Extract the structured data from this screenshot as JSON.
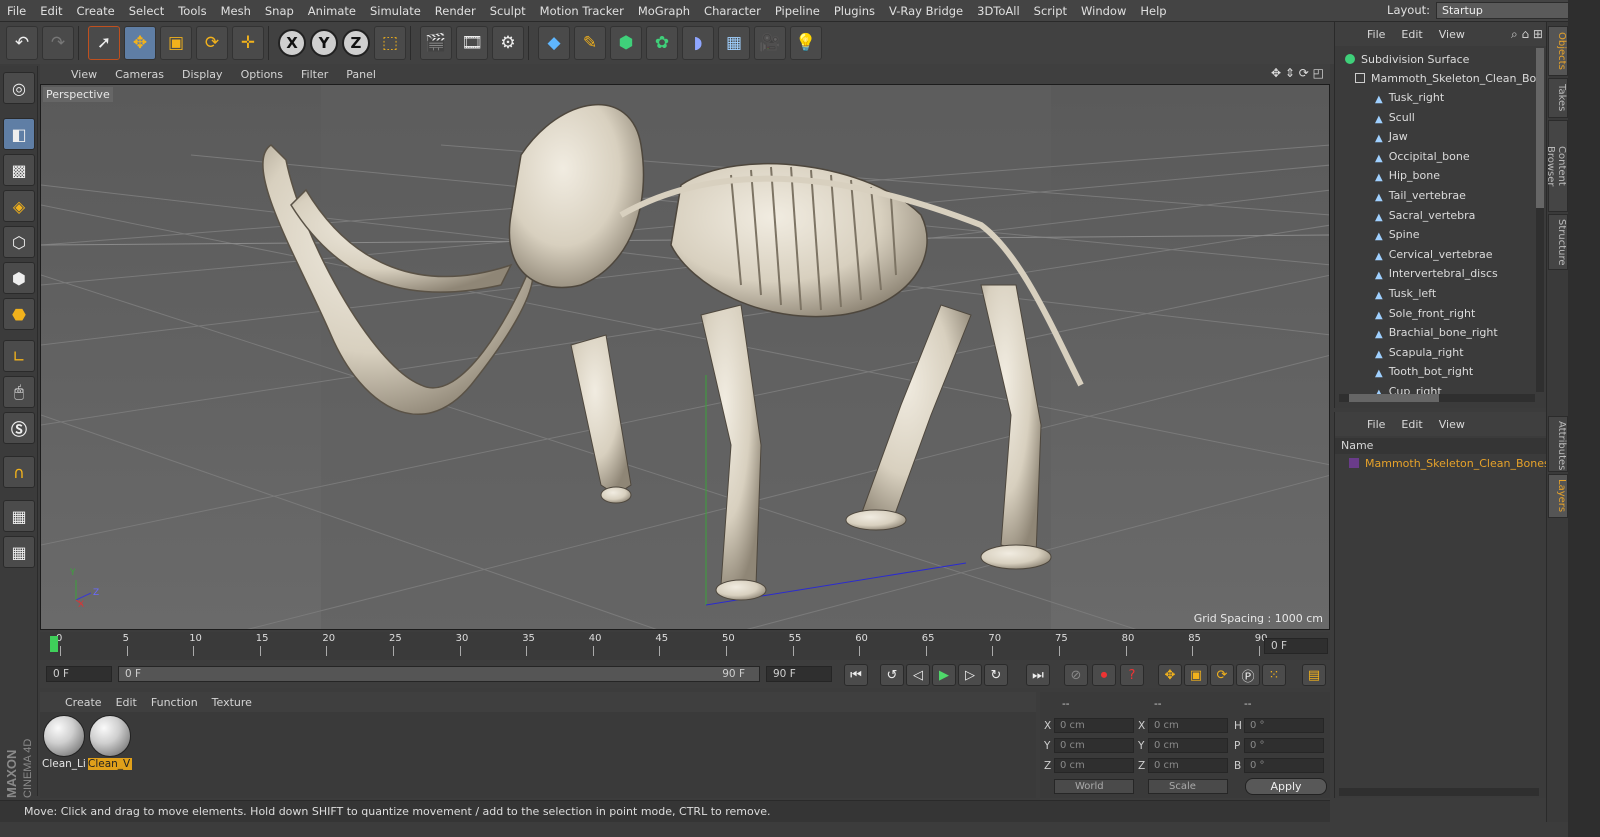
{
  "menubar": {
    "items": [
      "File",
      "Edit",
      "Create",
      "Select",
      "Tools",
      "Mesh",
      "Snap",
      "Animate",
      "Simulate",
      "Render",
      "Sculpt",
      "Motion Tracker",
      "MoGraph",
      "Character",
      "Pipeline",
      "Plugins",
      "V-Ray Bridge",
      "3DToAll",
      "Script",
      "Window",
      "Help"
    ],
    "layout_label": "Layout:",
    "layout_value": "Startup"
  },
  "toolbar": {
    "axis_x": "X",
    "axis_y": "Y",
    "axis_z": "Z"
  },
  "viewport": {
    "menu": [
      "View",
      "Cameras",
      "Display",
      "Options",
      "Filter",
      "Panel"
    ],
    "camera_label": "Perspective",
    "grid_spacing": "Grid Spacing : 1000 cm",
    "axis_labels": {
      "x": "X",
      "y": "Y",
      "z": "Z"
    }
  },
  "timeline": {
    "ticks": [
      "0",
      "5",
      "10",
      "15",
      "20",
      "25",
      "30",
      "35",
      "40",
      "45",
      "50",
      "55",
      "60",
      "65",
      "70",
      "75",
      "80",
      "85",
      "90"
    ],
    "current_frame": "0 F"
  },
  "transport": {
    "start_field": "0 F",
    "range_start": "0 F",
    "range_end": "90 F",
    "end_field": "90 F"
  },
  "material_manager": {
    "menu": [
      "Create",
      "Edit",
      "Function",
      "Texture"
    ],
    "materials": [
      {
        "name": "Clean_Li",
        "selected": false
      },
      {
        "name": "Clean_V",
        "selected": true
      }
    ]
  },
  "coordinates": {
    "header_a": "--",
    "header_b": "--",
    "header_c": "--",
    "rows": [
      {
        "l1": "X",
        "v1": "0 cm",
        "l2": "X",
        "v2": "0 cm",
        "l3": "H",
        "v3": "0 °"
      },
      {
        "l1": "Y",
        "v1": "0 cm",
        "l2": "Y",
        "v2": "0 cm",
        "l3": "P",
        "v3": "0 °"
      },
      {
        "l1": "Z",
        "v1": "0 cm",
        "l2": "Z",
        "v2": "0 cm",
        "l3": "B",
        "v3": "0 °"
      }
    ],
    "world": "World",
    "scale": "Scale",
    "apply": "Apply"
  },
  "status": "Move: Click and drag to move elements. Hold down SHIFT to quantize movement / add to the selection in point mode, CTRL to remove.",
  "object_manager": {
    "menu": [
      "File",
      "Edit",
      "View"
    ],
    "root": "Subdivision Surface",
    "group": "Mammoth_Skeleton_Clean_Bo",
    "children": [
      "Tusk_right",
      "Scull",
      "Jaw",
      "Occipital_bone",
      "Hip_bone",
      "Tail_vertebrae",
      "Sacral_vertebra",
      "Spine",
      "Cervical_vertebrae",
      "Intervertebral_discs",
      "Tusk_left",
      "Sole_front_right",
      "Brachial_bone_right",
      "Scapula_right",
      "Tooth_bot_right",
      "Cup_right"
    ]
  },
  "layer_manager": {
    "menu": [
      "File",
      "Edit",
      "View"
    ],
    "column": "Name",
    "layer": "Mammoth_Skeleton_Clean_Bones"
  },
  "right_tabs": {
    "top": [
      "Objects",
      "Takes",
      "Content Browser",
      "Structure"
    ],
    "bottom": [
      "Attributes",
      "Layers"
    ]
  },
  "logo": {
    "brand": "MAXON",
    "product": "CINEMA 4D"
  },
  "colors": {
    "accent": "#e6a22a",
    "selection": "#5f7ea5",
    "layer_color": "#6a3c8a",
    "bone_icon": "#9fd0ff"
  }
}
